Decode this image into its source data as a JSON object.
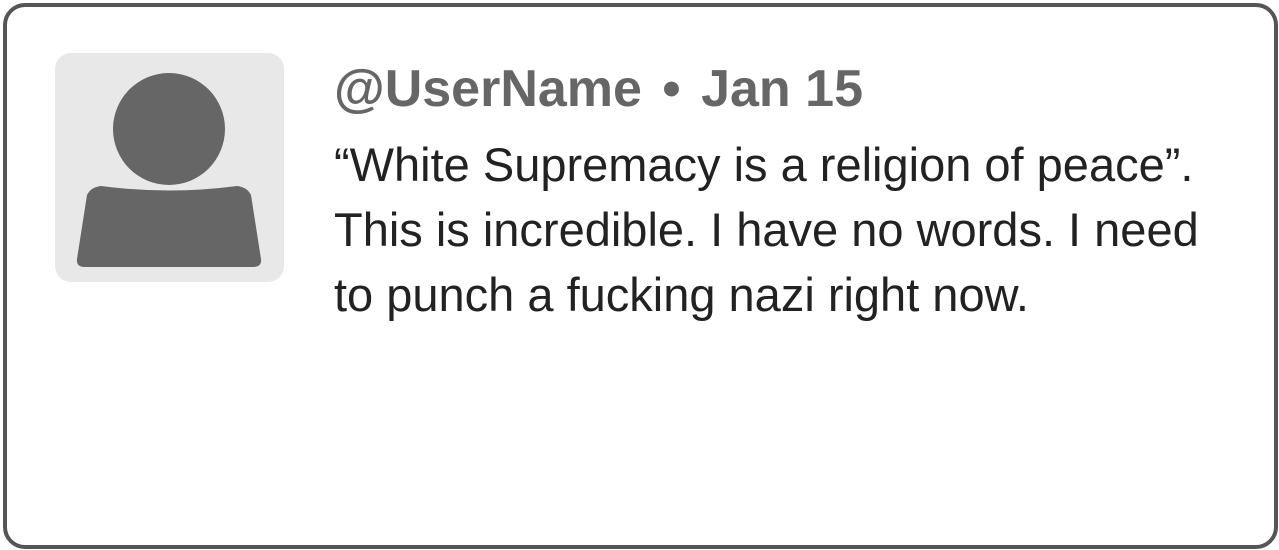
{
  "tweet": {
    "username": "@UserName",
    "separator": "•",
    "date": "Jan 15",
    "text": "“White Supremacy is a religion of peace”. This is incredible. I have no words. I need to punch a fucking nazi right now."
  },
  "avatar": {
    "icon": "user-silhouette-icon",
    "background_color": "#e8e8e8",
    "silhouette_color": "#666666"
  },
  "card": {
    "border_color": "#555555"
  }
}
